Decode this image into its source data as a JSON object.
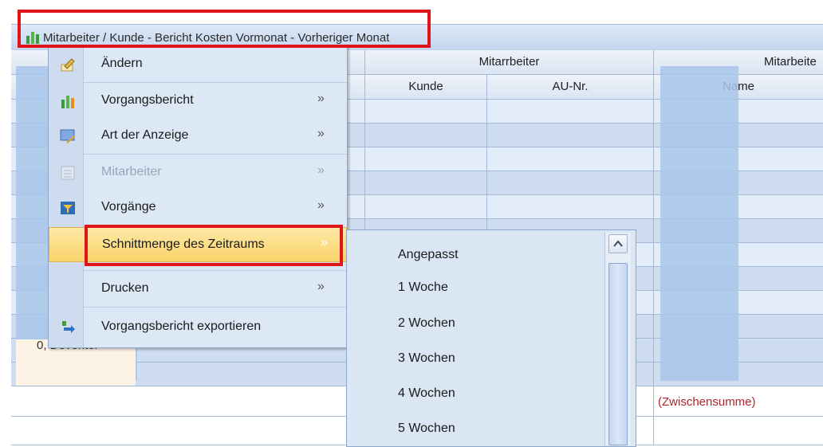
{
  "window": {
    "title": "Mitarbeiter / Kunde - Bericht Kosten Vormonat - Vorheriger Monat",
    "title_icon": "bar-chart-icon"
  },
  "grid": {
    "header_group_1": "Mitarrbeiter",
    "header_group_2": "Mitarbeite",
    "col_kunde": "Kunde",
    "col_au_nr": "AU-Nr.",
    "col_name": "Name",
    "partial_cell": "0, Deventer",
    "subtotal": "(Zwischensumme)"
  },
  "context_menu": {
    "items": [
      {
        "label": "Ändern",
        "icon": "edit-icon",
        "submenu": false,
        "enabled": true
      },
      {
        "label": "Vorgangsbericht",
        "icon": "bar-chart-icon",
        "submenu": true,
        "enabled": true
      },
      {
        "label": "Art der Anzeige",
        "icon": "display-icon",
        "submenu": true,
        "enabled": true
      },
      {
        "label": "Mitarbeiter",
        "icon": "employee-list-icon",
        "submenu": true,
        "enabled": false
      },
      {
        "label": "Vorgänge",
        "icon": "filter-list-icon",
        "submenu": true,
        "enabled": true
      },
      {
        "label": "Schnittmenge des Zeitraums",
        "icon": "",
        "submenu": true,
        "enabled": true,
        "active": true
      },
      {
        "label": "Drucken",
        "icon": "",
        "submenu": true,
        "enabled": true
      },
      {
        "label": "Vorgangsbericht exportieren",
        "icon": "export-icon",
        "submenu": false,
        "enabled": true
      }
    ],
    "submenu_arrow": "»"
  },
  "submenu": {
    "items": [
      "Angepasst",
      "1 Woche",
      "2 Wochen",
      "3 Wochen",
      "4 Wochen",
      "5 Wochen"
    ]
  },
  "colors": {
    "highlight_border": "#e0141b",
    "subtotal_text": "#b0242a",
    "active_item": "#fbd36a"
  }
}
